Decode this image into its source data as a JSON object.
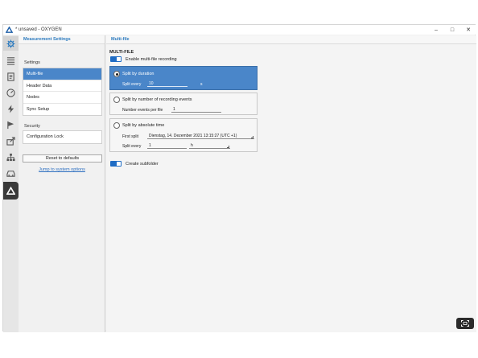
{
  "window": {
    "title": "* unsaved - OXYGEN"
  },
  "left_panel": {
    "header": "Measurement Settings",
    "settings_label": "Settings",
    "settings_items": [
      "Multi-file",
      "Header Data",
      "Nodes",
      "Sync Setup"
    ],
    "security_label": "Security",
    "security_items": [
      "Configuration Lock"
    ],
    "reset_button": "Reset to defaults",
    "system_link": "Jump to system options"
  },
  "main": {
    "header": "Multi-file",
    "section_title": "MULTI-FILE",
    "enable_label": "Enable multi-file recording",
    "option_duration": {
      "label": "Split by duration",
      "split_every_label": "Split every",
      "split_every_value": "10",
      "unit": "s"
    },
    "option_events": {
      "label": "Split by number of recording events",
      "events_label": "Number events per file",
      "events_value": "1"
    },
    "option_absolute": {
      "label": "Split by absolute time",
      "first_split_label": "First split",
      "first_split_value": "Dienstag, 14. Dezember 2021 13:15:27 (UTC +1)",
      "split_every_label": "Split every",
      "split_every_value": "1",
      "unit": "h"
    },
    "subfolder_label": "Create subfolder"
  },
  "colors": {
    "accent": "#2d7bbf",
    "selected": "#4a86c9",
    "toggle": "#1f6cc4"
  },
  "nav_icons": [
    "gear-icon",
    "list-icon",
    "document-icon",
    "gauge-icon",
    "flash-icon",
    "flag-icon",
    "export-icon",
    "network-icon",
    "car-icon",
    "triangle-logo-icon"
  ]
}
